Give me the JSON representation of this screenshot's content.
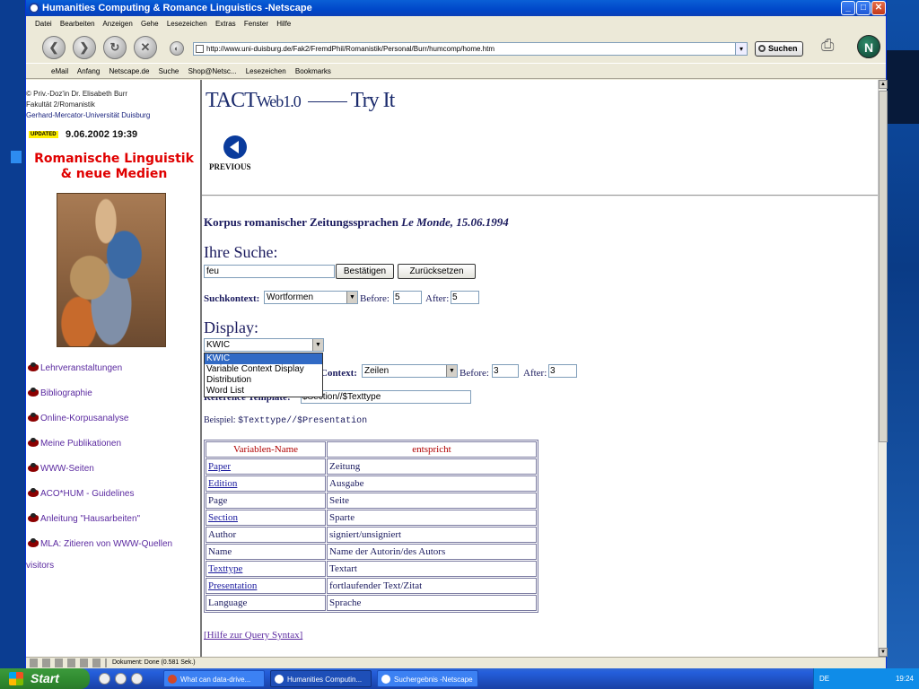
{
  "window": {
    "title": "Humanities Computing & Romance Linguistics -Netscape"
  },
  "menu": [
    "Datei",
    "Bearbeiten",
    "Anzeigen",
    "Gehe",
    "Lesezeichen",
    "Extras",
    "Fenster",
    "Hilfe"
  ],
  "nav": {
    "url": "http://www.uni-duisburg.de/Fak2/FremdPhil/Romanistik/Personal/Burr/humcomp/home.htm",
    "search_label": "Suchen"
  },
  "bookmarks": [
    "eMail",
    "Anfang",
    "Netscape.de",
    "Suche",
    "Shop@Netsc...",
    "Lesezeichen",
    "Bookmarks"
  ],
  "sidebar": {
    "credit_line1": "© Priv.-Doz'in Dr. Elisabeth Burr",
    "credit_line2": "Fakultät 2/Romanistik",
    "credit_line3": "Gerhard-Mercator-Universität Duisburg",
    "updated_badge": "UPDATED",
    "updated_date": "9.06.2002 19:39",
    "title_line1": "Romanische Linguistik",
    "title_line2": "& neue Medien",
    "links": [
      "Lehrveranstaltungen",
      "Bibliographie",
      "Online-Korpusanalyse",
      "Meine Publikationen",
      "WWW-Seiten",
      "ACO*HUM - Guidelines",
      "Anleitung \"Hausarbeiten\"",
      "MLA: Zitieren von WWW-Quellen"
    ],
    "visitors": "visitors"
  },
  "main": {
    "logo_tact": "TACT",
    "logo_web": "Web1.0",
    "logo_try": "Try It",
    "previous_label": "PREVIOUS",
    "korpus_heading": "Korpus romanischer Zeitungssprachen",
    "korpus_source": "Le Monde, 15.06.1994",
    "suche_heading": "Ihre Suche:",
    "query_value": "feu",
    "confirm_button": "Bestätigen",
    "reset_button": "Zurücksetzen",
    "suchkontext_label": "Suchkontext:",
    "suchkontext_value": "Wortformen",
    "before_label": "Before:",
    "before_value": "5",
    "after_label": "After:",
    "after_value": "5",
    "display_heading": "Display:",
    "display_value": "KWIC",
    "display_options": [
      "KWIC",
      "Variable Context Display",
      "Distribution",
      "Word List"
    ],
    "context_label": "Context:",
    "context_value": "Zeilen",
    "context_before_label": "Before:",
    "context_before_value": "3",
    "context_after_label": "After:",
    "context_after_value": "3",
    "reference_label": "Reference Template:",
    "reference_value": "$Section//$Texttype",
    "beispiel_label": "Beispiel:",
    "beispiel_code": "$Texttype//$Presentation",
    "table_headers": [
      "Variablen-Name",
      "entspricht"
    ],
    "table_rows": [
      {
        "name": "Paper",
        "value": "Zeitung"
      },
      {
        "name": "Edition",
        "value": "Ausgabe"
      },
      {
        "name": "Page",
        "value": "Seite"
      },
      {
        "name": "Section",
        "value": "Sparte"
      },
      {
        "name": "Author",
        "value": "signiert/unsigniert"
      },
      {
        "name": "Name",
        "value": "Name der Autorin/des Autors"
      },
      {
        "name": "Texttype",
        "value": "Textart"
      },
      {
        "name": "Presentation",
        "value": "fortlaufender Text/Zitat"
      },
      {
        "name": "Language",
        "value": "Sprache"
      }
    ],
    "help_link": "[Hilfe zur Query Syntax]"
  },
  "status": {
    "text": "Dokument: Done (0.581 Sek.)"
  },
  "taskbar": {
    "start": "Start",
    "tasks": [
      "What can data-drive...",
      "Humanities Computin...",
      "Suchergebnis -Netscape"
    ],
    "lang": "DE",
    "clock": "19:24"
  }
}
